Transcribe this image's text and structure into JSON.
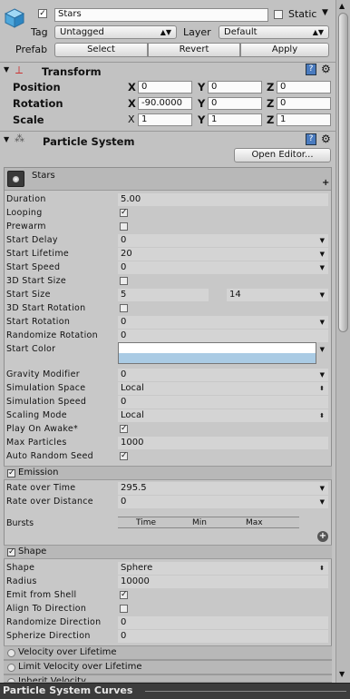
{
  "object": {
    "name": "Stars",
    "static_label": "Static",
    "tag_label": "Tag",
    "tag_value": "Untagged",
    "layer_label": "Layer",
    "layer_value": "Default",
    "prefab_label": "Prefab",
    "select_label": "Select",
    "revert_label": "Revert",
    "apply_label": "Apply"
  },
  "transform": {
    "title": "Transform",
    "position_label": "Position",
    "rotation_label": "Rotation",
    "scale_label": "Scale",
    "position": {
      "x": "0",
      "y": "0",
      "z": "0"
    },
    "rotation": {
      "x": "-90.0000",
      "y": "0",
      "z": "0"
    },
    "scale": {
      "x": "1",
      "y": "1",
      "z": "1"
    },
    "axis_x": "X",
    "axis_y": "Y",
    "axis_z": "Z"
  },
  "particle_system": {
    "title": "Particle System",
    "open_editor_label": "Open Editor...",
    "system_name": "Stars",
    "add_label": "+"
  },
  "main_props": [
    {
      "label": "Duration",
      "value": "5.00"
    },
    {
      "label": "Looping",
      "check": "✓"
    },
    {
      "label": "Prewarm",
      "check": ""
    },
    {
      "label": "Start Delay",
      "value": "0"
    },
    {
      "label": "Start Lifetime",
      "value": "20"
    },
    {
      "label": "Start Speed",
      "value": "0"
    },
    {
      "label": "3D Start Size",
      "check": ""
    },
    {
      "label": "Start Size",
      "value": "5",
      "value2": "14"
    },
    {
      "label": "3D Start Rotation",
      "check": ""
    },
    {
      "label": "Start Rotation",
      "value": "0"
    },
    {
      "label": "Randomize Rotation",
      "value": "0"
    },
    {
      "label": "Start Color"
    },
    {
      "label": "Gravity Modifier",
      "value": "0"
    },
    {
      "label": "Simulation Space",
      "value": "Local"
    },
    {
      "label": "Simulation Speed",
      "value": "0"
    },
    {
      "label": "Scaling Mode",
      "value": "Local"
    },
    {
      "label": "Play On Awake*",
      "check": "✓"
    },
    {
      "label": "Max Particles",
      "value": "1000"
    },
    {
      "label": "Auto Random Seed",
      "check": "✓"
    }
  ],
  "emission": {
    "title": "Emission",
    "check": "✓",
    "rate_time_label": "Rate over Time",
    "rate_time": "295.5",
    "rate_dist_label": "Rate over Distance",
    "rate_dist": "0",
    "bursts_label": "Bursts",
    "col_time": "Time",
    "col_min": "Min",
    "col_max": "Max"
  },
  "shape": {
    "title": "Shape",
    "check": "✓",
    "props": [
      {
        "label": "Shape",
        "value": "Sphere"
      },
      {
        "label": "Radius",
        "value": "10000"
      },
      {
        "label": "Emit from Shell",
        "check": "✓"
      },
      {
        "label": "Align To Direction",
        "check": ""
      },
      {
        "label": "Randomize Direction",
        "value": "0"
      },
      {
        "label": "Spherize Direction",
        "value": "0"
      }
    ]
  },
  "modules": [
    "Velocity over Lifetime",
    "Limit Velocity over Lifetime",
    "Inherit Velocity"
  ],
  "curves_title": "Particle System Curves"
}
